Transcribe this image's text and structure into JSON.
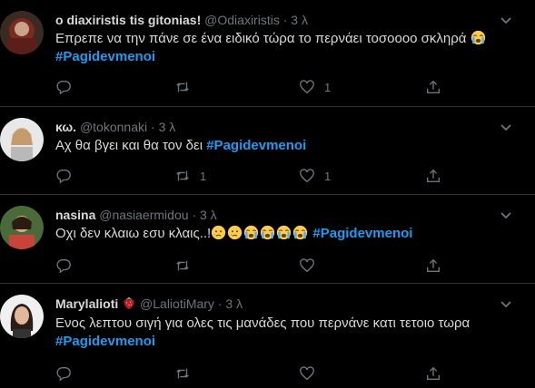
{
  "tweets": [
    {
      "name": "ο diaxiristis tis gitonias!",
      "handle": "@Odiaxiristis",
      "dot": "·",
      "time": "3 λ",
      "text": "Επρεπε να την πάνε σε ένα ειδικό τώρα το περνάει τοσοοοο σκληρά",
      "hashtag": "#Pagidevmenoi",
      "emojis": [
        "loudly-crying-face"
      ],
      "reply_count": "",
      "retweet_count": "",
      "like_count": "1"
    },
    {
      "name": "κω.",
      "handle": "@tokonnaki",
      "dot": "·",
      "time": "3 λ",
      "text": "Αχ θα βγει και θα τον δει",
      "hashtag": "#Pagidevmenoi",
      "emojis": [],
      "reply_count": "",
      "retweet_count": "1",
      "like_count": "1"
    },
    {
      "name": "nasina",
      "handle": "@nasiaermidou",
      "dot": "·",
      "time": "3 λ",
      "text": "Οχι δεν κλαιω εσυ κλαις..!",
      "hashtag": "#Pagidevmenoi",
      "emojis": [
        "crying-face",
        "crying-face",
        "loudly-crying-face",
        "loudly-crying-face",
        "loudly-crying-face",
        "loudly-crying-face"
      ],
      "reply_count": "",
      "retweet_count": "",
      "like_count": ""
    },
    {
      "name": "Marylalioti",
      "handle": "@LaliotiMary",
      "dot": "·",
      "time": "3 λ",
      "text": "Ενος λεπτου σιγή για ολες τις μανάδες που περνάνε κατι τετοιο τωρα",
      "hashtag": "#Pagidevmenoi",
      "emojis": [],
      "name_emoji": "strawberry",
      "reply_count": "",
      "retweet_count": "",
      "like_count": ""
    }
  ],
  "icons": {
    "reply": "reply-icon",
    "retweet": "retweet-icon",
    "like": "heart-icon",
    "share": "share-icon",
    "more": "chevron-down-icon"
  },
  "colors": {
    "background": "#000000",
    "text": "#d9d9d9",
    "secondary": "#6e767d",
    "hashtag": "#1d9bf0",
    "divider": "#2f3336"
  }
}
